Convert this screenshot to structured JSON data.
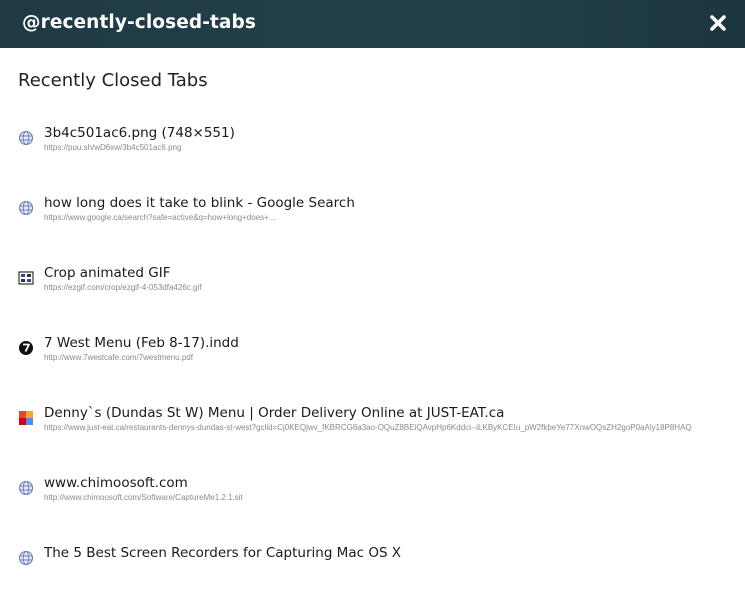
{
  "header": {
    "title": "@recently-closed-tabs"
  },
  "page": {
    "title": "Recently Closed Tabs"
  },
  "tabs": [
    {
      "title": "3b4c501ac6.png (748×551)",
      "url": "https://puu.sh/wD6xw/3b4c501ac6.png",
      "icon": "globe-icon"
    },
    {
      "title": "how long does it take to blink - Google Search",
      "url": "https://www.google.ca/search?safe=active&q=how+long+does+...",
      "icon": "globe-icon"
    },
    {
      "title": "Crop animated GIF",
      "url": "https://ezgif.com/crop/ezgif-4-053dfa426c.gif",
      "icon": "ezgif-icon"
    },
    {
      "title": "7 West Menu (Feb 8-17).indd",
      "url": "http://www.7westcafe.com/7westmenu.pdf",
      "icon": "7west-icon"
    },
    {
      "title": "Denny`s (Dundas St W) Menu | Order Delivery Online at JUST-EAT.ca",
      "url": "https://www.just-eat.ca/restaurants-dennys-dundas-st-west?gclid=Cj0KEQjwv_fKBRCG8a3ao-OQuZ8BEiQAvpHp6Kddci--iLKByKCEIu_pW2fkbeYe77XnwOQsZH2goP0aAly18P8HAQ",
      "icon": "justeat-icon"
    },
    {
      "title": "www.chimoosoft.com",
      "url": "http://www.chimoosoft.com/Software/CaptureMe1.2.1.sit",
      "icon": "globe-icon"
    },
    {
      "title": "The 5 Best Screen Recorders for Capturing Mac OS X",
      "url": "",
      "icon": "globe-icon"
    }
  ]
}
